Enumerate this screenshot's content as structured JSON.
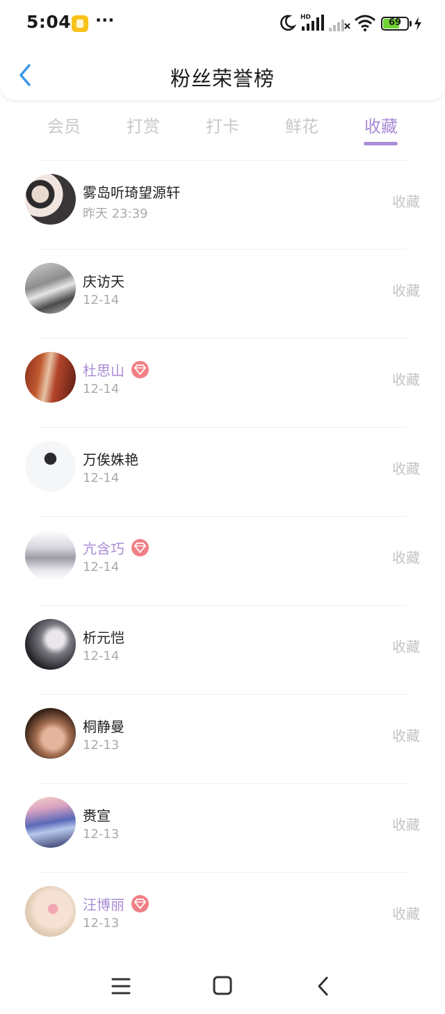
{
  "status_bar": {
    "time": "5:04",
    "battery_level": "69",
    "battery_fraction": 0.69,
    "icons": [
      "app-notification-icon",
      "more-dots-icon",
      "moon-icon",
      "hd-signal-icon",
      "signal-off-icon",
      "wifi-icon",
      "battery-icon",
      "charging-icon"
    ]
  },
  "header": {
    "title": "粉丝荣誉榜",
    "back_icon": "chevron-left-icon"
  },
  "tabs": [
    {
      "label": "会员"
    },
    {
      "label": "打赏"
    },
    {
      "label": "打卡"
    },
    {
      "label": "鲜花"
    },
    {
      "label": "收藏",
      "active": true
    }
  ],
  "fans": [
    {
      "name": "雾岛听琦望源轩",
      "date": "昨天 23:39",
      "action": "收藏",
      "vip": false
    },
    {
      "name": "庆访天",
      "date": "12-14",
      "action": "收藏",
      "vip": false
    },
    {
      "name": "杜思山",
      "date": "12-14",
      "action": "收藏",
      "vip": true
    },
    {
      "name": "万俟姝艳",
      "date": "12-14",
      "action": "收藏",
      "vip": false
    },
    {
      "name": "亢含巧",
      "date": "12-14",
      "action": "收藏",
      "vip": true
    },
    {
      "name": "析元恺",
      "date": "12-14",
      "action": "收藏",
      "vip": false
    },
    {
      "name": "桐静曼",
      "date": "12-13",
      "action": "收藏",
      "vip": false
    },
    {
      "name": "赉宣",
      "date": "12-13",
      "action": "收藏",
      "vip": false
    },
    {
      "name": "汪博丽",
      "date": "12-13",
      "action": "收藏",
      "vip": true
    }
  ],
  "nav_bar": {
    "icons": [
      "menu-icon",
      "home-icon",
      "back-icon"
    ]
  },
  "colors": {
    "accent": "#a98bd6",
    "vip_badge": "#f07f86",
    "battery": "#6fd334",
    "inactive_tab": "#c8c8c8"
  }
}
